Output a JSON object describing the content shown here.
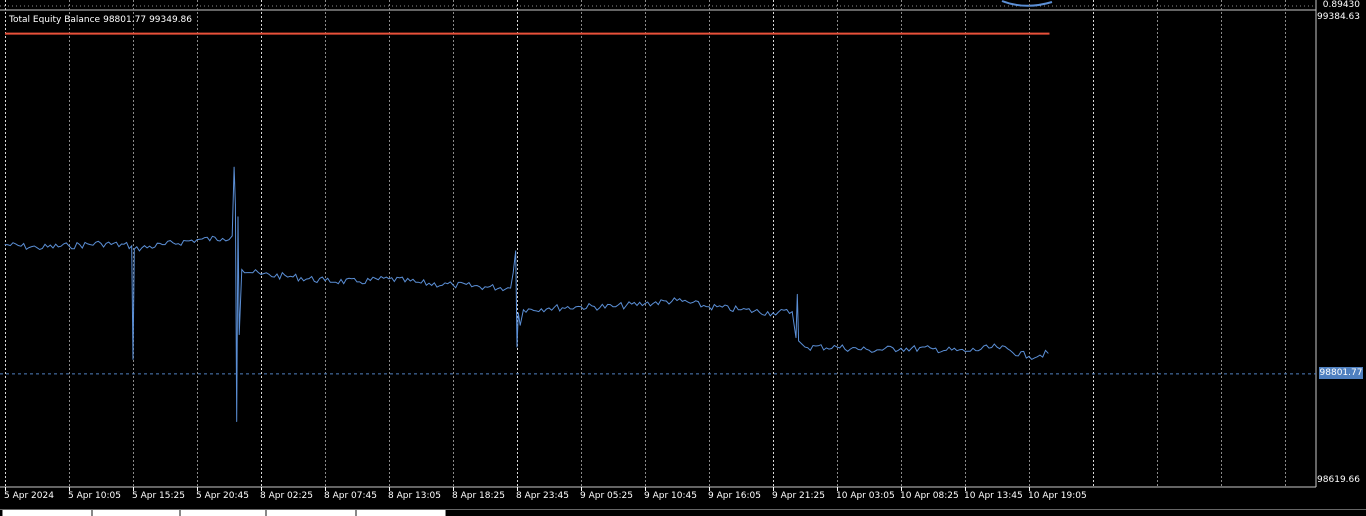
{
  "indicator": {
    "name": "Total Equity Balance",
    "equity_value": "98801.77",
    "balance_value": "99349.86"
  },
  "price_scale": {
    "top_panel_label": "0.89430",
    "max_label": "99384.63",
    "current_label": "98801.77",
    "min_label": "98619.66"
  },
  "time_axis": {
    "labels": [
      "5 Apr 2024",
      "5 Apr 10:05",
      "5 Apr 15:25",
      "5 Apr 20:45",
      "8 Apr 02:25",
      "8 Apr 07:45",
      "8 Apr 13:05",
      "8 Apr 18:25",
      "8 Apr 23:45",
      "9 Apr 05:25",
      "9 Apr 10:45",
      "9 Apr 16:05",
      "9 Apr 21:25",
      "10 Apr 03:05",
      "10 Apr 08:25",
      "10 Apr 13:45",
      "10 Apr 19:05"
    ]
  },
  "colors": {
    "background": "#000000",
    "grid": "#8a8a8a",
    "equity_line": "#5b8fd6",
    "balance_line": "#e8513a",
    "price_tag": "#4f80c0"
  },
  "chart_data": {
    "type": "line",
    "title": "Total Equity Balance",
    "xlabel": "",
    "ylabel": "",
    "ylim": [
      98619.66,
      99384.63
    ],
    "grid": true,
    "x_ticks": [
      "5 Apr 2024",
      "5 Apr 10:05",
      "5 Apr 15:25",
      "5 Apr 20:45",
      "8 Apr 02:25",
      "8 Apr 07:45",
      "8 Apr 13:05",
      "8 Apr 18:25",
      "8 Apr 23:45",
      "9 Apr 05:25",
      "9 Apr 10:45",
      "9 Apr 16:05",
      "9 Apr 21:25",
      "10 Apr 03:05",
      "10 Apr 08:25",
      "10 Apr 13:45",
      "10 Apr 19:05"
    ],
    "x_extent": [
      0,
      16.32
    ],
    "series": [
      {
        "name": "Equity",
        "x": [
          0,
          0.5,
          1,
          1.5,
          1.98,
          2.0,
          2.02,
          2.5,
          3,
          3.4,
          3.55,
          3.58,
          3.6,
          3.62,
          3.64,
          3.66,
          3.7,
          4,
          4.5,
          5,
          5.5,
          6,
          6.5,
          7,
          7.5,
          7.9,
          7.98,
          8.0,
          8.02,
          8.05,
          8.1,
          8.5,
          9,
          9.5,
          10,
          10.5,
          11,
          11.5,
          12,
          12.3,
          12.36,
          12.38,
          12.4,
          12.45,
          12.5,
          13,
          13.5,
          14,
          14.5,
          15,
          15.5,
          16,
          16.3
        ],
        "y": [
          99010,
          99005,
          99008,
          99012,
          99008,
          98825,
          99003,
          99010,
          99018,
          99020,
          99024,
          99135,
          99074,
          98725,
          99055,
          98865,
          98970,
          98962,
          98958,
          98952,
          98950,
          98955,
          98948,
          98945,
          98942,
          98940,
          99000,
          98845,
          98900,
          98880,
          98905,
          98908,
          98910,
          98910,
          98915,
          98920,
          98910,
          98905,
          98900,
          98902,
          98860,
          98930,
          98855,
          98850,
          98845,
          98845,
          98840,
          98843,
          98842,
          98838,
          98845,
          98830,
          98835
        ]
      },
      {
        "name": "Balance",
        "x": [
          0,
          16.32
        ],
        "y": [
          99349.86,
          99349.86
        ]
      }
    ]
  }
}
